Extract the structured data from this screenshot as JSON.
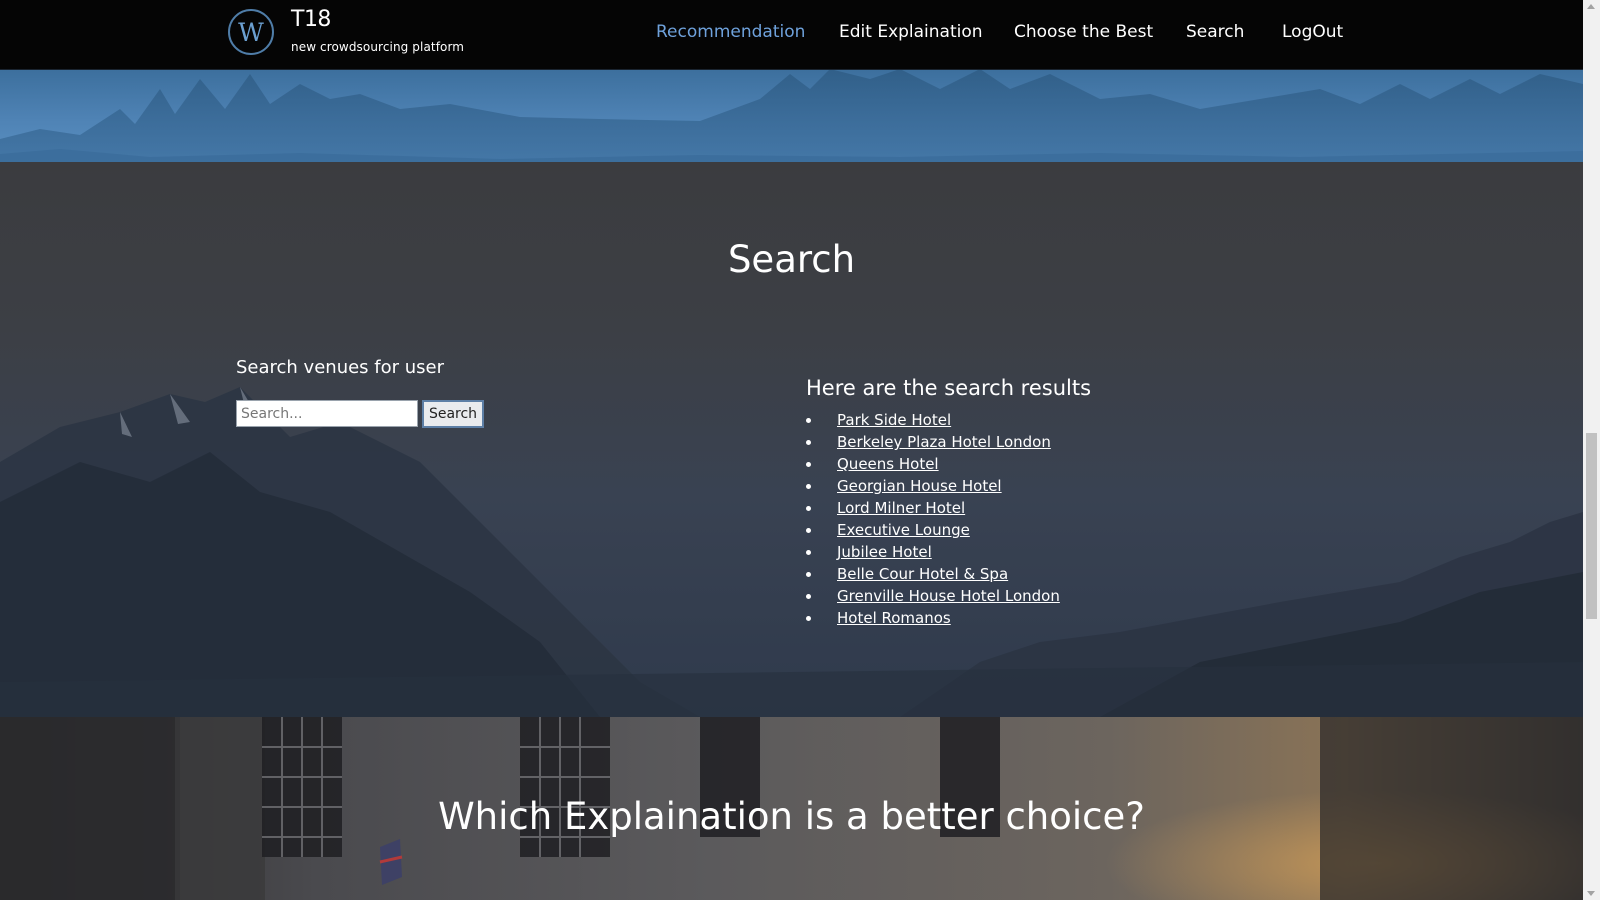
{
  "nav": {
    "logo_letter": "W",
    "brand_title": "T18",
    "brand_subtitle": "new crowdsourcing platform",
    "links": [
      {
        "label": "Recommendation",
        "active": true
      },
      {
        "label": "Edit Explaination",
        "active": false
      },
      {
        "label": "Choose the Best",
        "active": false
      },
      {
        "label": "Search",
        "active": false
      },
      {
        "label": "LogOut",
        "active": false
      }
    ]
  },
  "search_section": {
    "title": "Search",
    "form_label": "Search venues for user",
    "input_placeholder": "Search...",
    "input_value": "",
    "button_label": "Search",
    "results_title": "Here are the search results",
    "results": [
      "Park Side Hotel",
      "Berkeley Plaza Hotel London",
      "Queens Hotel",
      "Georgian House Hotel",
      "Lord Milner Hotel",
      "Executive Lounge",
      "Jubilee Hotel",
      "Belle Cour Hotel & Spa",
      "Grenville House Hotel London",
      "Hotel Romanos"
    ]
  },
  "bottom_section": {
    "title": "Which Explaination is a better choice?"
  },
  "colors": {
    "nav_background": "#050505",
    "active_link": "#6fa2dc",
    "text": "#ffffff"
  },
  "icons": {
    "logo": "w-circle-logo-icon",
    "bullet": "bullet-dot-icon"
  }
}
